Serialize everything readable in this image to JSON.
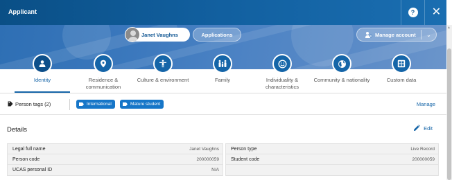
{
  "header": {
    "title": "Applicant",
    "help_label": "?",
    "close_label": "✕"
  },
  "hero": {
    "person_name": "Janet Vaughns",
    "applications_label": "Applications",
    "manage_account_label": "Manage account",
    "dropdown_icon": "chevron-down-icon"
  },
  "tabs": [
    {
      "label": "Identity",
      "icon": "person-icon",
      "active": true
    },
    {
      "label": "Residence & communication",
      "icon": "location-pin-icon",
      "active": false
    },
    {
      "label": "Culture & environment",
      "icon": "figure-icon",
      "active": false
    },
    {
      "label": "Family",
      "icon": "family-icon",
      "active": false
    },
    {
      "label": "Individuality & characteristics",
      "icon": "smiley-icon",
      "active": false
    },
    {
      "label": "Community & nationality",
      "icon": "globe-icon",
      "active": false
    },
    {
      "label": "Custom data",
      "icon": "grid-icon",
      "active": false
    }
  ],
  "tags": {
    "label": "Person tags (2)",
    "items": [
      "International",
      "Mature student"
    ],
    "manage_label": "Manage"
  },
  "details": {
    "title": "Details",
    "edit_label": "Edit",
    "left": [
      {
        "label": "Legal full name",
        "value": "Janet Vaughns"
      },
      {
        "label": "Person code",
        "value": "200000059"
      },
      {
        "label": "UCAS personal ID",
        "value": "N/A"
      }
    ],
    "right": [
      {
        "label": "Person type",
        "value": "Live Record"
      },
      {
        "label": "Student code",
        "value": "200000059"
      }
    ]
  },
  "colors": {
    "header_bg": "#0e5592",
    "accent": "#1565a8",
    "chip_bg": "#1676c8"
  }
}
